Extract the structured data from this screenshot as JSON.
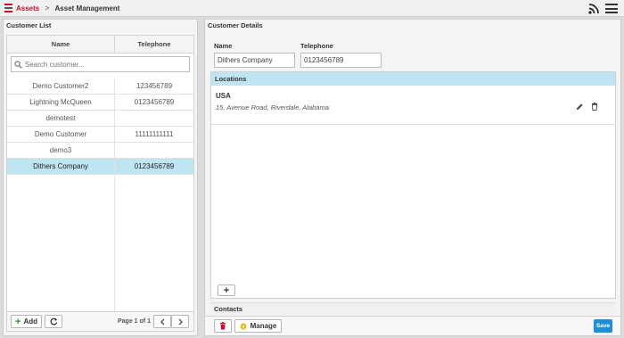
{
  "header": {
    "root_label": "Assets",
    "separator": ">",
    "current_label": "Asset Management",
    "icons": [
      "rss-icon",
      "menu-icon"
    ],
    "brand_color": "#c8102e"
  },
  "customer_list": {
    "title": "Customer List",
    "columns": [
      "Name",
      "Telephone"
    ],
    "search_placeholder": "Search customer...",
    "rows": [
      {
        "name": "Demo Customer2",
        "telephone": "123456789"
      },
      {
        "name": "Lightning McQueen",
        "telephone": "0123456789"
      },
      {
        "name": "demotest",
        "telephone": ""
      },
      {
        "name": "Demo Customer",
        "telephone": "11111111111"
      },
      {
        "name": "demo3",
        "telephone": ""
      },
      {
        "name": "Dithers Company",
        "telephone": "0123456789",
        "selected": true
      }
    ],
    "add_label": "Add",
    "pager_text": "Page 1 of 1",
    "selected_row_color": "#bfe4f2"
  },
  "customer_details": {
    "title": "Customer Details",
    "name_label": "Name",
    "name_value": "Dithers Company",
    "telephone_label": "Telephone",
    "telephone_value": "0123456789",
    "locations_title": "Locations",
    "locations": [
      {
        "country": "USA",
        "address": "15, Avenue Road, Riverdale, Alabama."
      }
    ],
    "add_location_label": "+",
    "contacts_title": "Contacts",
    "manage_label": "Manage",
    "save_label": "Save",
    "save_color": "#1e8fd6"
  }
}
